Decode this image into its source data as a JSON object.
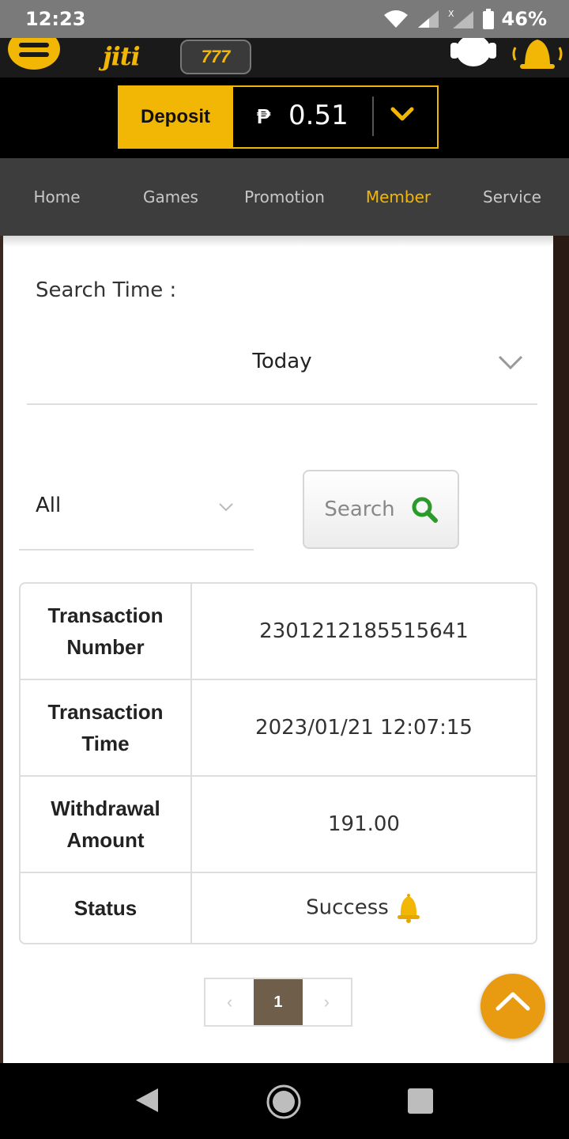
{
  "status_bar": {
    "time": "12:23",
    "battery": "46%"
  },
  "header": {
    "logo": "jiti",
    "slot_text": "777"
  },
  "wallet": {
    "deposit_label": "Deposit",
    "currency": "₱",
    "balance": "0.51"
  },
  "nav": {
    "items": [
      "Home",
      "Games",
      "Promotion",
      "Member",
      "Service"
    ],
    "active": "Member"
  },
  "filters": {
    "search_time_label": "Search Time :",
    "time_value": "Today",
    "type_value": "All",
    "search_label": "Search"
  },
  "transaction": {
    "rows": [
      {
        "label": "Transaction Number",
        "value": "2301212185515641"
      },
      {
        "label": "Transaction Time",
        "value": "2023/01/21 12:07:15"
      },
      {
        "label": "Withdrawal Amount",
        "value": "191.00"
      },
      {
        "label": "Status",
        "value": "Success"
      }
    ]
  },
  "pagination": {
    "current": "1",
    "prev": "‹",
    "next": "›"
  },
  "colors": {
    "accent": "#f2b705",
    "nav_bg": "#3d3d3d",
    "search_icon": "#2a9a2a"
  }
}
